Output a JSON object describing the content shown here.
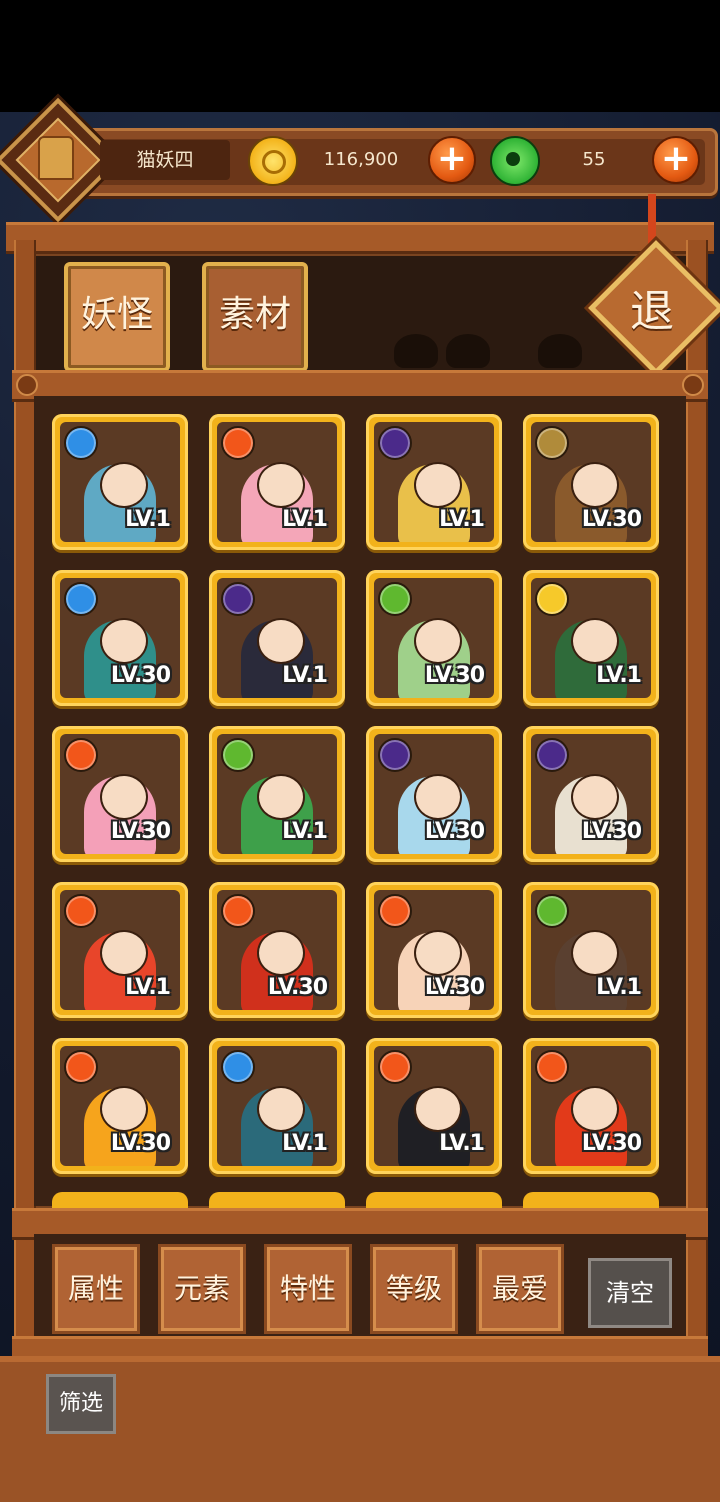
{
  "player": {
    "name": "猫妖四"
  },
  "currency": {
    "gold": "116,900",
    "jade": "55",
    "add_symbol": "+"
  },
  "tabs": [
    {
      "label": "妖怪",
      "active": true
    },
    {
      "label": "素材",
      "active": false
    }
  ],
  "exit_label": "退",
  "monsters": [
    {
      "element": "water",
      "level": "LV.1",
      "palette": "#5fa9c4"
    },
    {
      "element": "fire",
      "level": "LV.1",
      "palette": "#f4a6b8"
    },
    {
      "element": "dark",
      "level": "LV.1",
      "palette": "#e9c04a"
    },
    {
      "element": "earth",
      "level": "LV.30",
      "palette": "#8a5a2c"
    },
    {
      "element": "water",
      "level": "LV.30",
      "palette": "#2f8f8a"
    },
    {
      "element": "dark",
      "level": "LV.1",
      "palette": "#2a2a3a"
    },
    {
      "element": "wood",
      "level": "LV.30",
      "palette": "#9fd08a"
    },
    {
      "element": "light",
      "level": "LV.1",
      "palette": "#2f6b3a"
    },
    {
      "element": "fire",
      "level": "LV.30",
      "palette": "#f4a0b8"
    },
    {
      "element": "wood",
      "level": "LV.1",
      "palette": "#3ea04a"
    },
    {
      "element": "dark",
      "level": "LV.30",
      "palette": "#a8d8ec"
    },
    {
      "element": "dark",
      "level": "LV.30",
      "palette": "#e8e0d0"
    },
    {
      "element": "fire",
      "level": "LV.1",
      "palette": "#e8452a"
    },
    {
      "element": "fire",
      "level": "LV.30",
      "palette": "#d0301c"
    },
    {
      "element": "fire",
      "level": "LV.30",
      "palette": "#f7d3b8"
    },
    {
      "element": "wood",
      "level": "LV.1",
      "palette": "#5a4030"
    },
    {
      "element": "fire",
      "level": "LV.30",
      "palette": "#f6a41c"
    },
    {
      "element": "water",
      "level": "LV.1",
      "palette": "#2b6a7a"
    },
    {
      "element": "fire",
      "level": "LV.1",
      "palette": "#1f1f24"
    },
    {
      "element": "fire",
      "level": "LV.30",
      "palette": "#e23a1a"
    }
  ],
  "element_colors": {
    "water": "#2f8fe6",
    "fire": "#f2561a",
    "dark": "#4b2a8a",
    "earth": "#b08b3a",
    "wood": "#5fb82f",
    "light": "#f6c92a"
  },
  "filters": [
    {
      "label": "属性"
    },
    {
      "label": "元素"
    },
    {
      "label": "特性"
    },
    {
      "label": "等级"
    },
    {
      "label": "最爱"
    }
  ],
  "clear_label": "清空",
  "screen_label": "筛选"
}
